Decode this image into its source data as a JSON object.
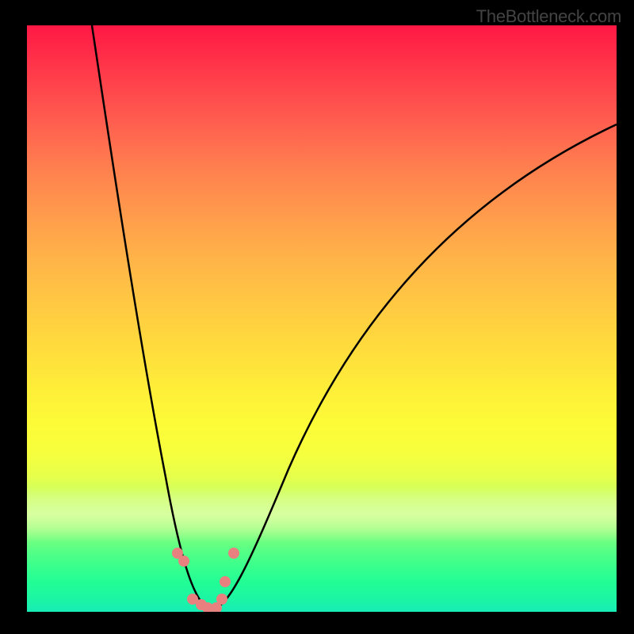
{
  "watermark": "TheBottleneck.com",
  "chart_data": {
    "type": "line",
    "title": "",
    "xlabel": "",
    "ylabel": "",
    "ylim": [
      0,
      100
    ],
    "xlim": [
      0,
      100
    ],
    "background_gradient": {
      "top": "#ff1844",
      "bottom": "#18ecb6",
      "description": "vertical rainbow gradient red→orange→yellow→green"
    },
    "series": [
      {
        "name": "left-curve",
        "points": [
          {
            "x": 11,
            "y": 100
          },
          {
            "x": 15,
            "y": 72
          },
          {
            "x": 18,
            "y": 52
          },
          {
            "x": 21,
            "y": 34
          },
          {
            "x": 24,
            "y": 18
          },
          {
            "x": 27,
            "y": 6
          },
          {
            "x": 29,
            "y": 1
          },
          {
            "x": 31,
            "y": 0
          }
        ]
      },
      {
        "name": "right-curve",
        "points": [
          {
            "x": 31,
            "y": 0
          },
          {
            "x": 34,
            "y": 3
          },
          {
            "x": 38,
            "y": 12
          },
          {
            "x": 42,
            "y": 22
          },
          {
            "x": 48,
            "y": 34
          },
          {
            "x": 55,
            "y": 46
          },
          {
            "x": 62,
            "y": 55
          },
          {
            "x": 70,
            "y": 63
          },
          {
            "x": 78,
            "y": 70
          },
          {
            "x": 86,
            "y": 75
          },
          {
            "x": 94,
            "y": 80
          },
          {
            "x": 100,
            "y": 83
          }
        ]
      }
    ],
    "scatter_points": [
      {
        "x": 25.5,
        "y": 10
      },
      {
        "x": 26.5,
        "y": 8.5
      },
      {
        "x": 28,
        "y": 2
      },
      {
        "x": 29.5,
        "y": 1
      },
      {
        "x": 30.5,
        "y": 0.5
      },
      {
        "x": 32,
        "y": 0.5
      },
      {
        "x": 33,
        "y": 2
      },
      {
        "x": 33.5,
        "y": 5
      },
      {
        "x": 35,
        "y": 10
      }
    ],
    "scatter_color": "#e88080"
  }
}
